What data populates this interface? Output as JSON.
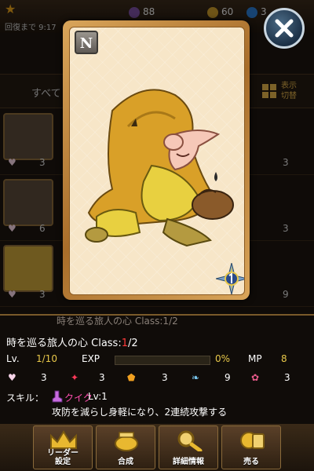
{
  "topbar": {
    "recover": "回復まで 9:17",
    "stat1": "88",
    "stat2": "60",
    "stat3": "3"
  },
  "filter": {
    "label": "すべて",
    "toggle_line1": "表示",
    "toggle_line2": "切替"
  },
  "bg_list": {
    "rows": [
      {
        "heart": "3",
        "right": "3"
      },
      {
        "heart": "6",
        "right": "3"
      },
      {
        "heart": "3",
        "right": "9"
      }
    ]
  },
  "card": {
    "rarity": "N"
  },
  "info": {
    "behind_title": "時を巡る旅人の心 Class:1/2",
    "name": "時を巡る旅人の心 Class:",
    "class_current": "1",
    "class_max": "/2",
    "lv_label": "Lv.",
    "lv_value": "1/10",
    "exp_label": "EXP",
    "exp_percent": "0%",
    "exp_fraction": 0,
    "mp_label": "MP",
    "mp_value": "8",
    "stats": [
      "3",
      "3",
      "3",
      "9",
      "3"
    ],
    "skill_label": "スキル：",
    "skill_name": "クイク",
    "skill_lv": "Lv:1",
    "skill_desc": "攻防を減らし身軽になり、2連続攻撃する"
  },
  "menu": {
    "leader_line1": "リーダー",
    "leader_line2": "設定",
    "compose": "合成",
    "detail": "詳細情報",
    "sell": "売る"
  },
  "colors": {
    "accent": "#e2b24a",
    "class_current": "#ff3a3a",
    "skill_name": "#ff4fb0",
    "mp": "#e8c84a"
  }
}
